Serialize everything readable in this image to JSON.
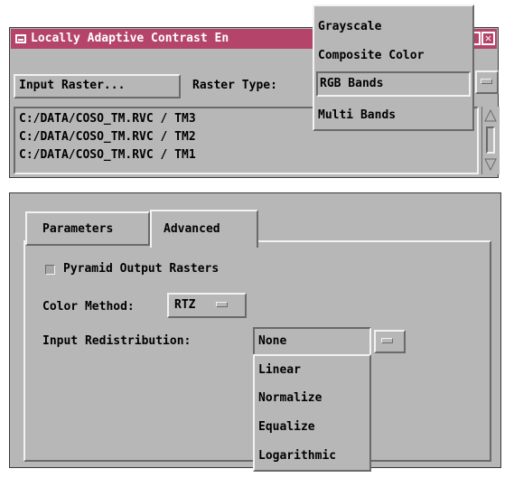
{
  "window1": {
    "title": "Locally Adaptive Contrast En",
    "input_raster_button": "Input Raster...",
    "raster_type_label": "Raster Type:",
    "raster_files": [
      "C:/DATA/COSO_TM.RVC / TM3",
      "C:/DATA/COSO_TM.RVC / TM2",
      "C:/DATA/COSO_TM.RVC / TM1"
    ]
  },
  "raster_type_menu": {
    "options": [
      "Grayscale",
      "Composite Color",
      "RGB Bands",
      "Multi Bands"
    ],
    "selected": "RGB Bands"
  },
  "window2": {
    "tabs": [
      "Parameters",
      "Advanced"
    ],
    "active_tab": "Advanced",
    "pyramid_label": "Pyramid Output Rasters",
    "pyramid_checked": false,
    "color_method_label": "Color Method:",
    "color_method_value": "RTZ",
    "input_redistribution_label": "Input Redistribution:",
    "input_redistribution_value": "None"
  },
  "redistribution_menu": {
    "options": [
      "Linear",
      "Normalize",
      "Equalize",
      "Logarithmic"
    ]
  },
  "colors": {
    "titlebar": "#b5446b",
    "panel": "#b7b7b7"
  }
}
